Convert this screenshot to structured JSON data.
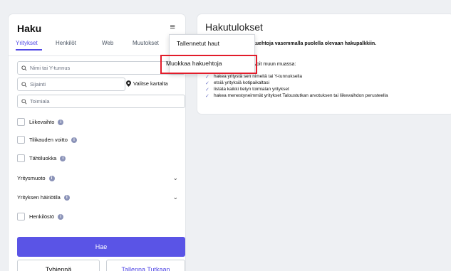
{
  "left_panel": {
    "title": "Haku",
    "tabs": [
      {
        "label": "Yritykset"
      },
      {
        "label": "Henkilöt"
      },
      {
        "label": "Web"
      },
      {
        "label": "Muutokset"
      }
    ],
    "active_tab": "Yritykset",
    "fields": {
      "name_placeholder": "Nimi tai Y-tunnus",
      "location_placeholder": "Sijainti",
      "map_button": "Valitse kartalta",
      "industry_placeholder": "Toimiala"
    },
    "filters": {
      "revenue": "Liikevaihto",
      "profit": "Tilikauden voitto",
      "star_class": "Tähtiluokka",
      "company_form": "Yritysmuoto",
      "disruption_status": "Yrityksen häiriötila",
      "staff": "Henkilöstö"
    },
    "buttons": {
      "search": "Hae",
      "clear": "Tyhjennä",
      "save": "Tallenna Tutkaan"
    }
  },
  "dropdown": {
    "items": [
      {
        "label": "Tallennetut haut"
      },
      {
        "label": "Muokkaa hakuehtoja"
      }
    ],
    "highlight_color": "#e21c2a"
  },
  "results": {
    "title": "Hakutulokset",
    "intro_bold": "ä hakuehtoja vasemmalla puolella olevaan hakupalkkiin.",
    "intro_tail": "uun, voit muun muassa:",
    "bullets": [
      "hakea yritystä sen nimellä tai Y-tunnuksella",
      "etsiä yrityksiä kotipaikaltasi",
      "listata kaikki tietyn toimialan yritykset",
      "hakea menestyneimmät yritykset Taloustutkan arvotuksen tai liikevaihdon perusteella"
    ]
  },
  "colors": {
    "accent": "#4f46e5",
    "primary_button": "#5a54e6",
    "background": "#eef0f3"
  },
  "icons": {
    "menu": "hamburger-menu-icon",
    "search": "search-icon",
    "map_pin": "map-pin-icon",
    "info": "info-icon",
    "chevron": "chevron-down-icon",
    "check": "check-icon"
  }
}
